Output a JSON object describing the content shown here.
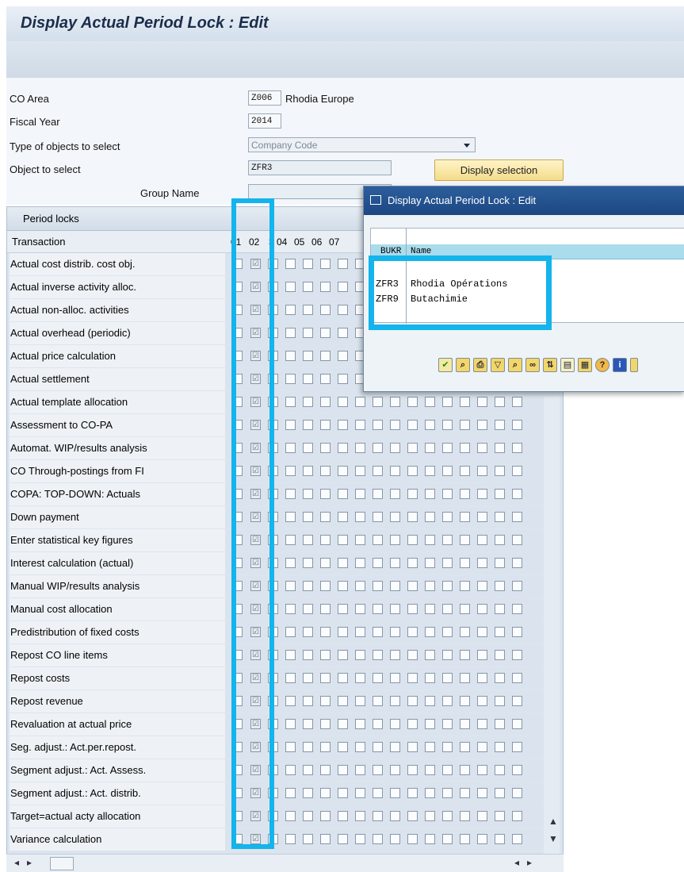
{
  "window": {
    "title": "Display Actual Period Lock : Edit"
  },
  "selection": {
    "co_area_label": "CO Area",
    "co_area_value": "Z006",
    "co_area_text": "Rhodia Europe",
    "fiscal_year_label": "Fiscal Year",
    "fiscal_year_value": "2014",
    "type_label": "Type of objects to select",
    "type_value": "Company Code",
    "object_label": "Object to select",
    "object_value": "ZFR3",
    "group_label": "Group Name",
    "display_button": "Display selection"
  },
  "grid": {
    "caption": "Period locks",
    "col_transaction": "Transaction",
    "periods": [
      "01",
      "02",
      "3",
      "04",
      "05",
      "06",
      "07"
    ],
    "rows": [
      "Actual cost distrib. cost obj.",
      "Actual inverse activity alloc.",
      "Actual non-alloc. activities",
      "Actual overhead (periodic)",
      "Actual price calculation",
      "Actual settlement",
      "Actual template allocation",
      "Assessment to CO-PA",
      "Automat. WIP/results analysis",
      "CO Through-postings from FI",
      "COPA: TOP-DOWN: Actuals",
      "Down payment",
      "Enter statistical key figures",
      "Interest calculation (actual)",
      "Manual WIP/results analysis",
      "Manual cost allocation",
      "Predistribution of fixed costs",
      "Repost CO line items",
      "Repost costs",
      "Repost revenue",
      "Revaluation at actual price",
      "Seg. adjust.: Act.per.repost.",
      "Segment adjust.: Act. Assess.",
      "Segment adjust.: Act. distrib.",
      "Target=actual acty allocation",
      "Variance calculation"
    ],
    "checked_period": "02"
  },
  "dialog": {
    "title": "Display Actual Period Lock : Edit",
    "col_bukrs": "BUKR",
    "col_name": "Name",
    "rows": [
      {
        "code": "ZFR3",
        "name": "Rhodia Opérations"
      },
      {
        "code": "ZFR9",
        "name": "Butachimie"
      }
    ]
  },
  "colors": {
    "highlight": "#14b4ec",
    "dialog_title": "#1d4783",
    "button": "#f4dc8a"
  },
  "icons": [
    "check-icon",
    "find-icon",
    "print-icon",
    "filter-icon",
    "find-next-icon",
    "binoculars-icon",
    "sort-icon",
    "export-icon",
    "table-icon",
    "help-icon",
    "info-icon"
  ]
}
